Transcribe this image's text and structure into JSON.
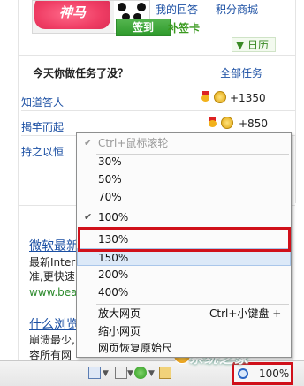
{
  "profile": {
    "avatar_text": "神马",
    "link_answers": "我的回答",
    "link_mall": "积分商城",
    "signin_label": "签到",
    "makeup_label": "补签卡",
    "calendar_label": "▼ 日历"
  },
  "tasks": {
    "title": "今天你做任务了没？",
    "all_link": "全部任务",
    "items": [
      {
        "name": "知道答人",
        "reward": "+1350"
      },
      {
        "name": "揭竿而起",
        "reward": "+850"
      },
      {
        "name": "持之以恒",
        "reward": ""
      }
    ]
  },
  "articles": [
    {
      "title": "微软最新",
      "lines": [
        "最新Intern",
        "准,更快速"
      ],
      "url": "www.bea"
    },
    {
      "title": "什么浏览",
      "lines": [
        "崩溃最少,",
        "容所有网"
      ],
      "url": ""
    }
  ],
  "zoom_menu": {
    "header": "Ctrl+鼠标滚轮",
    "levels": [
      "30%",
      "50%",
      "70%",
      "100%",
      "130%",
      "150%",
      "200%",
      "400%"
    ],
    "checked": "100%",
    "highlighted": "130%",
    "hovered": "150%",
    "actions": [
      {
        "label": "放大网页",
        "shortcut": "Ctrl+小键盘 +"
      },
      {
        "label": "缩小网页",
        "shortcut": ""
      },
      {
        "label": "网页恢复原始尺",
        "shortcut": ""
      }
    ]
  },
  "statusbar": {
    "zoom_value": "100%",
    "watermark": "系统之家"
  },
  "colors": {
    "highlight_border": "#d0101a",
    "link": "#1b4fa3",
    "signin_green": "#2f9a2c"
  }
}
